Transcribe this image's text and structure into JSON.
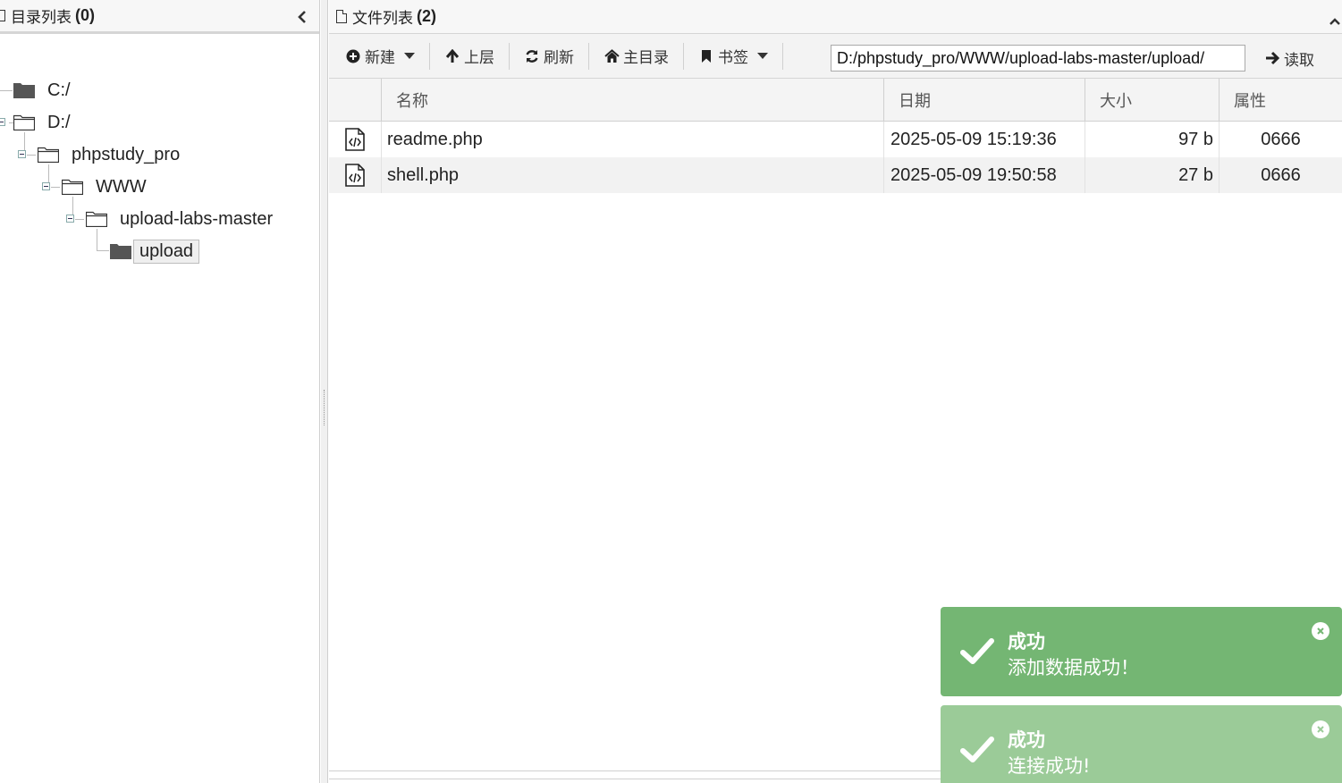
{
  "dir_panel": {
    "title": "目录列表",
    "count": "(0)",
    "tree": [
      {
        "label": "C:/"
      },
      {
        "label": "D:/"
      },
      {
        "label": "phpstudy_pro"
      },
      {
        "label": "WWW"
      },
      {
        "label": "upload-labs-master"
      },
      {
        "label": "upload"
      }
    ]
  },
  "file_panel": {
    "title": "文件列表",
    "count": "(2)",
    "toolbar": {
      "new_label": "新建",
      "up_label": "上层",
      "refresh_label": "刷新",
      "home_label": "主目录",
      "bookmark_label": "书签",
      "path_value": "D:/phpstudy_pro/WWW/upload-labs-master/upload/",
      "read_label": "读取"
    },
    "columns": [
      "名称",
      "日期",
      "大小",
      "属性"
    ],
    "files": [
      {
        "name": "readme.php",
        "date": "2025-05-09 15:19:36",
        "size": "97 b",
        "attr": "0666"
      },
      {
        "name": "shell.php",
        "date": "2025-05-09 19:50:58",
        "size": "27 b",
        "attr": "0666"
      }
    ]
  },
  "toasts": [
    {
      "title": "成功",
      "message": "添加数据成功！",
      "color": "#74b673"
    },
    {
      "title": "成功",
      "message": "连接成功!",
      "color": "#9bcb98"
    }
  ],
  "icons": {
    "drive": "folder-filled-icon",
    "folder": "folder-open-icon",
    "file": "code-file-icon",
    "toast": "check-icon"
  }
}
